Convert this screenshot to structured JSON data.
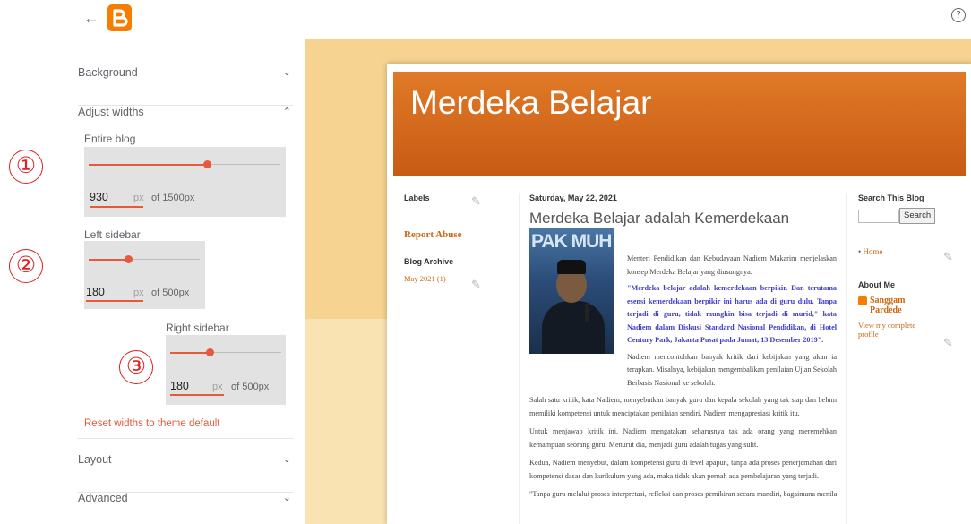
{
  "header": {
    "back_glyph": "←",
    "help_glyph": "?"
  },
  "panel": {
    "background_label": "Background",
    "adjust_widths_label": "Adjust widths",
    "layout_label": "Layout",
    "advanced_label": "Advanced",
    "chevron_down": "⌄",
    "chevron_up": "⌃",
    "reset_label": "Reset widths to theme default",
    "entire_blog": {
      "label": "Entire blog",
      "value": "930",
      "unit": "px",
      "max_text": "of 1500px",
      "fraction": 0.62
    },
    "left_sidebar": {
      "label": "Left sidebar",
      "value": "180",
      "unit": "px",
      "max_text": "of 500px",
      "fraction": 0.36
    },
    "right_sidebar": {
      "label": "Right sidebar",
      "value": "180",
      "unit": "px",
      "max_text": "of 500px",
      "fraction": 0.36
    },
    "markers": [
      "①",
      "②",
      "③"
    ]
  },
  "colors": {
    "accent": "#e8583a",
    "blog_header": "#e07a27",
    "link": "#cc6611",
    "quote": "#3d3dc8"
  },
  "blog": {
    "title": "Merdeka Belajar",
    "left": {
      "labels_title": "Labels",
      "report_abuse": "Report Abuse",
      "archive_title": "Blog Archive",
      "archive_item": "May 2021 (1)"
    },
    "post": {
      "date": "Saturday, May 22, 2021",
      "title": "Merdeka Belajar adalah Kemerdekaan Berpikir",
      "photo_text": "PAK MUH",
      "intro": "Menteri Pendidikan dan Kebudayaan Nadiem Makarim menjelaskan konsep Merdeka Belajar yang diusungnya.",
      "quote": "\"Merdeka belajar adalah kemerdekaan berpikir. Dan terutama esensi kemerdekaan berpikir ini harus ada di guru dulu. Tanpa terjadi di guru, tidak mungkin bisa terjadi di murid,\" kata Nadiem dalam Diskusi Standard Nasional Pendidikan, di Hotel Century Park, Jakarta Pusat pada Jumat, 13 Desember 2019\".",
      "p1": "Nadiem mencontohkan banyak kritik dari kebijakan yang akan ia terapkan. Misalnya, kebijakan mengembalikan penilaian Ujian Sekolah Berbasis Nasional ke sekolah.",
      "p2": "Salah satu kritik, kata Nadiem, menyebutkan banyak guru dan kepala sekolah yang tak siap dan belum memiliki kompetensi untuk menciptakan penilaian sendiri. Nadiem mengapresiasi kritik itu.",
      "p3": "Untuk menjawab kritik ini, Nadiem mengatakan seharusnya tak ada orang yang meremehkan kemampuan seorang guru. Menurut dia, menjadi guru adalah tugas yang sulit.",
      "p4": "Kedua, Nadiem menyebut, dalam kompetensi guru di level apapun, tanpa ada proses penerjemahan dari kompetensi dasar dan kurikulum yang ada, maka tidak akan pernah ada pembelajaran yang terjadi.",
      "p5": "\"Tanpa guru melalui proses interpretasi, refleksi dan proses pemikiran secara mandiri, bagaimana menilai"
    },
    "right": {
      "search_title": "Search This Blog",
      "search_button": "Search",
      "home_link": "Home",
      "about_title": "About Me",
      "author": "Sanggam Pardede",
      "profile_link": "View my complete profile"
    }
  }
}
